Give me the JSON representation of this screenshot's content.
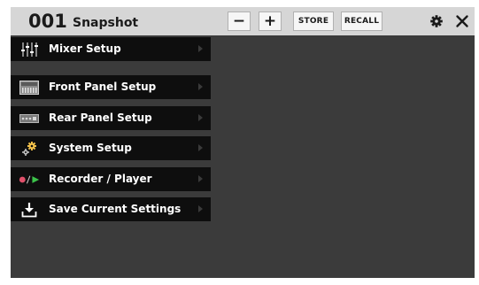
{
  "header": {
    "scene_number": "001",
    "scene_name": "Snapshot",
    "minus_label": "−",
    "plus_label": "+",
    "store_label": "STORE",
    "recall_label": "RECALL",
    "settings_icon": "gear-icon",
    "close_icon": "close-icon"
  },
  "menu": {
    "items": [
      {
        "label": "Mixer Setup",
        "icon": "mixer-faders-icon"
      },
      {
        "label": "Front Panel Setup",
        "icon": "front-panel-icon"
      },
      {
        "label": "Rear Panel Setup",
        "icon": "rear-panel-icon"
      },
      {
        "label": "System Setup",
        "icon": "system-gears-icon"
      },
      {
        "label": "Recorder / Player",
        "icon": "record-play-icon"
      },
      {
        "label": "Save Current Settings",
        "icon": "save-download-icon"
      }
    ]
  },
  "colors": {
    "background": "#3b3b3b",
    "header_bar": "#d6d6d6",
    "menu_item": "#0e0e0e",
    "record_red": "#e0506a",
    "play_green": "#3cc34a"
  }
}
